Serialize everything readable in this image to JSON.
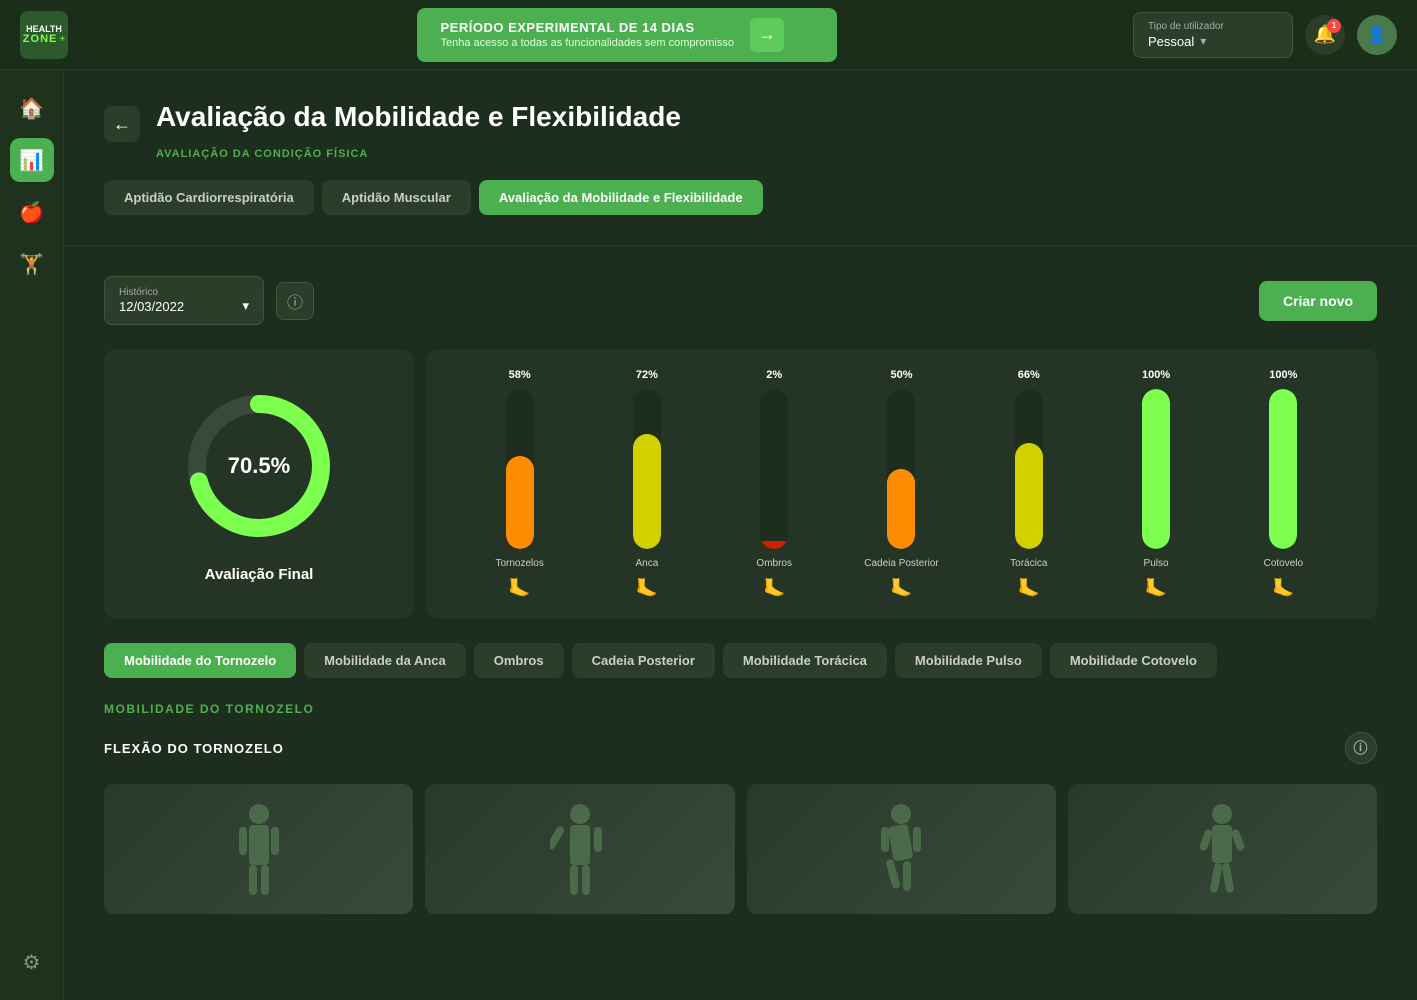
{
  "topbar": {
    "logo": {
      "line1": "HEALTH",
      "line2": "ZONE",
      "plus": "+"
    },
    "promo": {
      "title": "PERÍODO EXPERIMENTAL DE 14 DIAS",
      "subtitle": "Tenha acesso a todas as funcionalidades sem compromisso",
      "arrow": "→"
    },
    "user_type": {
      "label": "Tipo de utilizador",
      "value": "Pessoal",
      "chevron": "▾"
    },
    "notification_count": "1",
    "user_icon": "👤"
  },
  "sidebar": {
    "items": [
      {
        "id": "home",
        "icon": "🏠",
        "active": false
      },
      {
        "id": "chart",
        "icon": "📊",
        "active": true
      },
      {
        "id": "apple",
        "icon": "🍎",
        "active": false
      },
      {
        "id": "dumbbell",
        "icon": "🏋",
        "active": false
      },
      {
        "id": "settings",
        "icon": "⚙",
        "active": false
      }
    ]
  },
  "page": {
    "title": "Avaliação da Mobilidade e Flexibilidade",
    "subtitle": "AVALIAÇÃO DA CONDIÇÃO FÍSICA",
    "back_arrow": "←"
  },
  "tabs": [
    {
      "id": "cardio",
      "label": "Aptidão Cardiorrespiratória",
      "active": false
    },
    {
      "id": "muscular",
      "label": "Aptidão Muscular",
      "active": false
    },
    {
      "id": "mobility",
      "label": "Avaliação da Mobilidade e Flexibilidade",
      "active": true
    }
  ],
  "controls": {
    "historico_label": "Histórico",
    "historico_value": "12/03/2022",
    "chevron": "▾",
    "info_icon": "ⓘ",
    "criar_label": "Criar novo"
  },
  "donut_chart": {
    "percentage": 70.5,
    "display": "70.5%",
    "label": "Avaliação Final",
    "bg_color": "#3a3a3a",
    "fill_color": "#7dff4f",
    "track_color": "#444"
  },
  "bar_chart": {
    "bars": [
      {
        "id": "tornozelos",
        "label": "Tornozelos",
        "pct": 58,
        "pct_label": "58%",
        "color": "#ff8c00"
      },
      {
        "id": "anca",
        "label": "Anca",
        "pct": 72,
        "pct_label": "72%",
        "color": "#d4d000"
      },
      {
        "id": "ombros",
        "label": "Ombros",
        "pct": 2,
        "pct_label": "2%",
        "color": "#cc2200"
      },
      {
        "id": "cadeia",
        "label": "Cadeia Posterior",
        "pct": 50,
        "pct_label": "50%",
        "color": "#ff8c00"
      },
      {
        "id": "toracica",
        "label": "Torácica",
        "pct": 66,
        "pct_label": "66%",
        "color": "#d4d000"
      },
      {
        "id": "pulso",
        "label": "Pulso",
        "pct": 100,
        "pct_label": "100%",
        "color": "#7dff4f"
      },
      {
        "id": "cotovelo",
        "label": "Cotovelo",
        "pct": 100,
        "pct_label": "100%",
        "color": "#7dff4f"
      }
    ],
    "max_height": 160
  },
  "tabs2": [
    {
      "id": "tornozelo",
      "label": "Mobilidade do Tornozelo",
      "active": true
    },
    {
      "id": "anca",
      "label": "Mobilidade da Anca",
      "active": false
    },
    {
      "id": "ombros",
      "label": "Ombros",
      "active": false
    },
    {
      "id": "cadeia",
      "label": "Cadeia Posterior",
      "active": false
    },
    {
      "id": "toracica",
      "label": "Mobilidade Torácica",
      "active": false
    },
    {
      "id": "pulso",
      "label": "Mobilidade Pulso",
      "active": false
    },
    {
      "id": "cotovelo",
      "label": "Mobilidade Cotovelo",
      "active": false
    }
  ],
  "section": {
    "title": "MOBILIDADE DO TORNOZELO",
    "subsection_title": "FLEXÃO DO TORNOZELO",
    "info_icon": "ⓘ"
  },
  "images": [
    {
      "id": "img1",
      "alt": "Exercise image 1"
    },
    {
      "id": "img2",
      "alt": "Exercise image 2"
    },
    {
      "id": "img3",
      "alt": "Exercise image 3"
    },
    {
      "id": "img4",
      "alt": "Exercise image 4"
    }
  ]
}
